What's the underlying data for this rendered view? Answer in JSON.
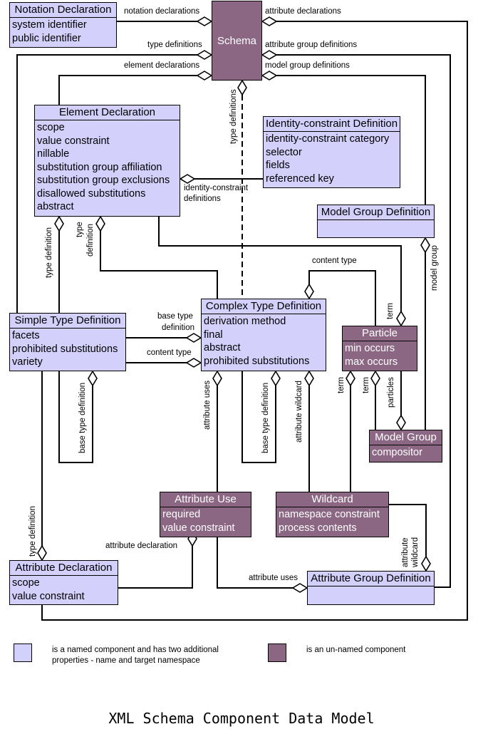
{
  "title": "XML Schema Component Data Model",
  "colors": {
    "named": "#d4d0fc",
    "unnamed": "#8c6784",
    "line": "#000000"
  },
  "components": {
    "schema": {
      "name": "Schema",
      "kind": "unnamed",
      "properties": []
    },
    "notation": {
      "name": "Notation Declaration",
      "kind": "named",
      "properties": [
        "system identifier",
        "public identifier"
      ]
    },
    "element": {
      "name": "Element Declaration",
      "kind": "named",
      "properties": [
        "scope",
        "value constraint",
        "nillable",
        "substitution group affiliation",
        "substitution group exclusions",
        "disallowed substitutions",
        "abstract"
      ]
    },
    "identity": {
      "name": "Identity-constraint Definition",
      "kind": "named",
      "properties": [
        "identity-constraint category",
        "selector",
        "fields",
        "referenced key"
      ]
    },
    "mgdef": {
      "name": "Model Group Definition",
      "kind": "named",
      "properties": []
    },
    "simple": {
      "name": "Simple Type Definition",
      "kind": "named",
      "properties": [
        "facets",
        "prohibited substitutions",
        "variety"
      ]
    },
    "complex": {
      "name": "Complex Type Definition",
      "kind": "named",
      "properties": [
        "derivation method",
        "final",
        "abstract",
        "prohibited substitutions"
      ]
    },
    "particle": {
      "name": "Particle",
      "kind": "unnamed",
      "properties": [
        "min occurs",
        "max occurs"
      ]
    },
    "modelgroup": {
      "name": "Model Group",
      "kind": "unnamed",
      "properties": [
        "compositor"
      ]
    },
    "attruse": {
      "name": "Attribute Use",
      "kind": "unnamed",
      "properties": [
        "required",
        "value constraint"
      ]
    },
    "wildcard": {
      "name": "Wildcard",
      "kind": "unnamed",
      "properties": [
        "namespace constraint",
        "process contents"
      ]
    },
    "attrdecl": {
      "name": "Attribute Declaration",
      "kind": "named",
      "properties": [
        "scope",
        "value constraint"
      ]
    },
    "attrgroup": {
      "name": "Attribute Group Definition",
      "kind": "named",
      "properties": []
    }
  },
  "relationships": [
    {
      "from": "Schema",
      "to": "Notation Declaration",
      "label": "notation declarations"
    },
    {
      "from": "Schema",
      "to": "Simple Type Definition",
      "label": "type definitions"
    },
    {
      "from": "Schema",
      "to": "Element Declaration",
      "label": "element declarations"
    },
    {
      "from": "Schema",
      "to": "Attribute Declaration",
      "label": "attribute declarations"
    },
    {
      "from": "Schema",
      "to": "Attribute Group Definition",
      "label": "attribute group definitions"
    },
    {
      "from": "Schema",
      "to": "Model Group Definition",
      "label": "model group definitions"
    },
    {
      "from": "Schema",
      "to": "Complex Type Definition",
      "label": "type definitions",
      "style": "dashed"
    },
    {
      "from": "Element Declaration",
      "to": "Identity-constraint Definition",
      "label": "identity-constraint definitions"
    },
    {
      "from": "Element Declaration",
      "to": "Simple Type Definition",
      "label": "type definition"
    },
    {
      "from": "Element Declaration",
      "to": "Complex Type Definition",
      "label": "type definition"
    },
    {
      "from": "Complex Type Definition",
      "to": "Simple Type Definition",
      "label": "base type definition"
    },
    {
      "from": "Complex Type Definition",
      "to": "Simple Type Definition",
      "label": "content type"
    },
    {
      "from": "Complex Type Definition",
      "to": "Particle",
      "label": "content type"
    },
    {
      "from": "Complex Type Definition",
      "to": "Attribute Use",
      "label": "attribute uses"
    },
    {
      "from": "Complex Type Definition",
      "to": "Complex Type Definition",
      "label": "base type definition"
    },
    {
      "from": "Complex Type Definition",
      "to": "Wildcard",
      "label": "attribute wildcard"
    },
    {
      "from": "Simple Type Definition",
      "to": "Simple Type Definition",
      "label": "base type definition"
    },
    {
      "from": "Particle",
      "to": "Element Declaration",
      "label": "term"
    },
    {
      "from": "Particle",
      "to": "Wildcard",
      "label": "term"
    },
    {
      "from": "Particle",
      "to": "Model Group",
      "label": "term"
    },
    {
      "from": "Model Group",
      "to": "Particle",
      "label": "particles"
    },
    {
      "from": "Model Group Definition",
      "to": "Model Group",
      "label": "model group"
    },
    {
      "from": "Attribute Declaration",
      "to": "Simple Type Definition",
      "label": "type definition"
    },
    {
      "from": "Attribute Use",
      "to": "Attribute Declaration",
      "label": "attribute declaration"
    },
    {
      "from": "Attribute Group Definition",
      "to": "Attribute Use",
      "label": "attribute uses"
    },
    {
      "from": "Attribute Group Definition",
      "to": "Wildcard",
      "label": "attribute wildcard"
    }
  ],
  "labels": {
    "notation_declarations": "notation declarations",
    "type_definitions_left": "type definitions",
    "element_declarations": "element declarations",
    "attribute_declarations": "attribute declarations",
    "attribute_group_definitions": "attribute group definitions",
    "model_group_definitions": "model group definitions",
    "type_definitions_dashed": "type definitions",
    "identity_constraint_1": "identity-constraint",
    "identity_constraint_2": "definitions",
    "type_definition_simple": "type definition",
    "type_definition_complex_1": "type",
    "type_definition_complex_2": "definition",
    "content_type_particle": "content type",
    "term_element": "term",
    "model_group": "model group",
    "base_type_definition_1": "base type",
    "base_type_definition_2": "definition",
    "content_type_simple": "content type",
    "base_type_simple": "base type definition",
    "attribute_uses_complex": "attribute uses",
    "base_type_complex": "base type definition",
    "attribute_wildcard_complex": "attribute wildcard",
    "term_wildcard": "term",
    "term_modelgroup": "term",
    "particles": "particles",
    "type_definition_attr": "type definition",
    "attribute_declaration": "attribute declaration",
    "attribute_uses_group": "attribute uses",
    "attribute_wildcard_group_1": "attribute",
    "attribute_wildcard_group_2": "wildcard"
  },
  "legend": [
    {
      "kind": "named",
      "text_line1": "is a named component and has two additional",
      "text_line2": "properties - name and target namespace"
    },
    {
      "kind": "unnamed",
      "text_line1": "is an un-named component"
    }
  ]
}
